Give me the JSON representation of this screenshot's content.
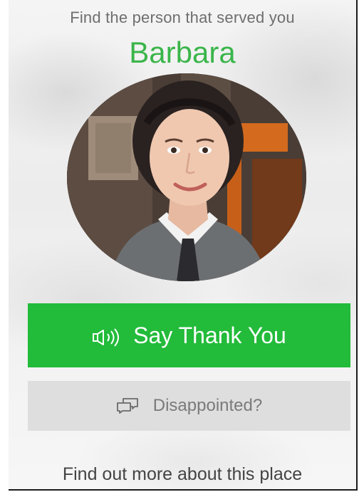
{
  "header": {
    "subtitle": "Find the person that served you",
    "server_name": "Barbara"
  },
  "avatar": {
    "description_icon": "person-photo"
  },
  "actions": {
    "thank_label": "Say Thank You",
    "thank_icon": "speaker-icon",
    "disappointed_label": "Disappointed?",
    "disappointed_icon": "chat-bubbles-icon"
  },
  "footer": {
    "more_label": "Find out more about this place"
  },
  "colors": {
    "accent_green": "#22bb3a",
    "name_green": "#3ab54a",
    "secondary_button": "#dedede"
  }
}
